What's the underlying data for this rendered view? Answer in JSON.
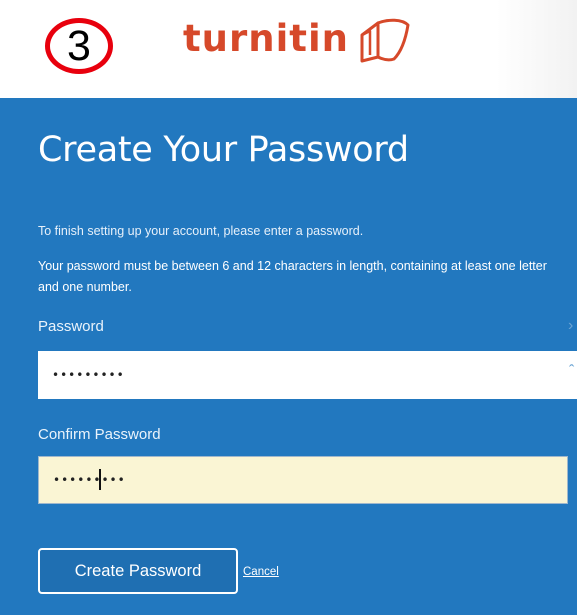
{
  "header": {
    "step_number": "3",
    "logo_text": "turnitin",
    "logo_icon": "turnitin-mark-icon",
    "step_badge_color": "#e8000d",
    "brand_color": "#d6492a"
  },
  "form": {
    "title": "Create Your Password",
    "instruction": "To finish setting up your account, please enter a password.",
    "requirement": "Your password must be between 6 and 12 characters in length, containing at least one letter and one number.",
    "password": {
      "label": "Password",
      "value": "•••••••••"
    },
    "confirm_password": {
      "label": "Confirm Password",
      "value": "•••••••••"
    },
    "submit_label": "Create Password",
    "cancel_label": "Cancel",
    "panel_color": "#2278bf"
  }
}
